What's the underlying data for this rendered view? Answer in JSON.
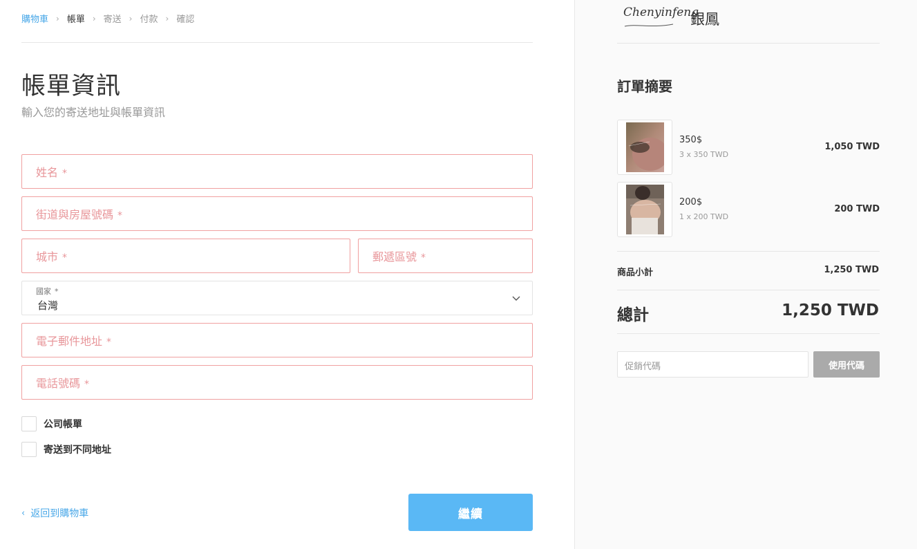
{
  "breadcrumb": {
    "items": [
      {
        "label": "購物車",
        "state": "link"
      },
      {
        "label": "帳單",
        "state": "current"
      },
      {
        "label": "寄送",
        "state": "upcoming"
      },
      {
        "label": "付款",
        "state": "upcoming"
      },
      {
        "label": "確認",
        "state": "upcoming"
      }
    ],
    "separator": "›"
  },
  "page": {
    "title": "帳單資訊",
    "subtitle": "輸入您的寄送地址與帳單資訊"
  },
  "form": {
    "required_mark": "*",
    "name_placeholder": "姓名",
    "street_placeholder": "街道與房屋號碼",
    "city_placeholder": "城市",
    "postal_placeholder": "郵遞區號",
    "country_label": "國家",
    "country_value": "台灣",
    "email_placeholder": "電子郵件地址",
    "phone_placeholder": "電話號碼",
    "company_checkbox_label": "公司帳單",
    "different_address_checkbox_label": "寄送到不同地址"
  },
  "actions": {
    "back_label": "返回到購物車",
    "continue_label": "繼續"
  },
  "brand": {
    "script_name": "Chenyinfeng",
    "name": "銀鳳"
  },
  "summary": {
    "title": "訂單摘要",
    "items": [
      {
        "name": "350$",
        "quantity_line": "3 x 350 TWD",
        "line_total": "1,050 TWD"
      },
      {
        "name": "200$",
        "quantity_line": "1 x 200 TWD",
        "line_total": "200 TWD"
      }
    ],
    "subtotal_label": "商品小計",
    "subtotal_value": "1,250 TWD",
    "total_label": "總計",
    "total_value": "1,250 TWD",
    "promo_placeholder": "促銷代碼",
    "promo_button": "使用代碼"
  },
  "colors": {
    "accent": "#4aa8e8",
    "continue_button": "#5ab8f5",
    "required_field_border": "#f0a0a0",
    "placeholder_text": "#e8969a",
    "promo_button": "#aaaaaa",
    "sidebar_background": "#fafafa"
  }
}
